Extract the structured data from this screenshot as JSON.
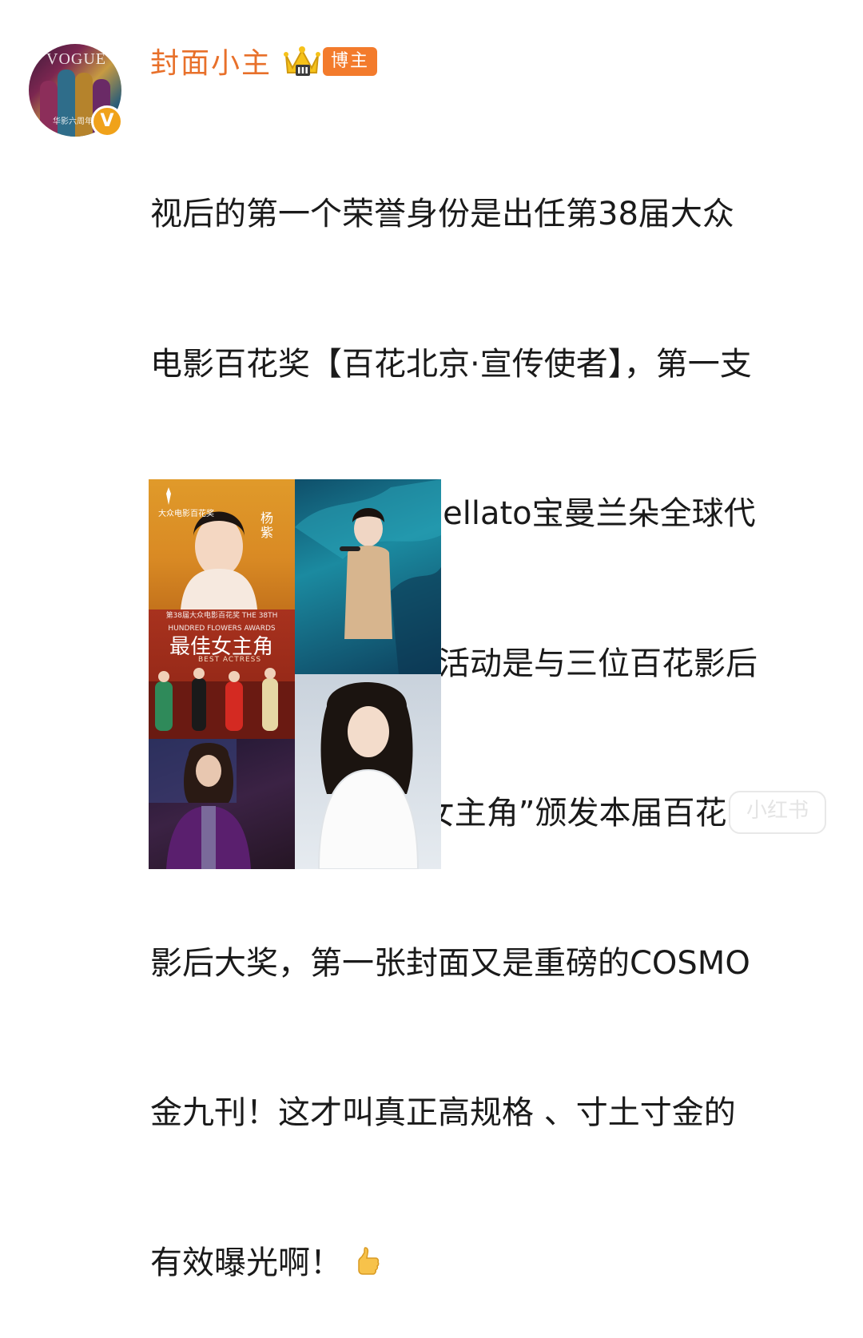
{
  "user": {
    "name": "封面小主",
    "badge": "博主",
    "avatar_text": "VOGUE",
    "avatar_subtext": "华影六周年",
    "verified_mark": "V"
  },
  "post": {
    "lines": [
      "视后的第一个荣誉身份是出任第38届大众",
      "电影百花奖【百花北京·宣传使者】，第一支",
      "商务代言是拿下Pomellato宝曼兰朵全球代",
      "言合约，第一场盛典活动是与三位百花影后",
      "同台作为四代“最佳女主角”颁发本届百花",
      "影后大奖，第一张封面又是重磅的COSMO",
      "金九刊！这才叫真正高规格 、寸土寸金的",
      "有效曝光啊！"
    ],
    "emoji": "thumbs-up-icon"
  },
  "images": {
    "tile1_logo": "大众电影百花奖",
    "tile1_vertical": "杨紫",
    "tile3_banner": "第38届大众电影百花奖 THE 38TH HUNDRED FLOWERS AWARDS",
    "tile3_title": "最佳女主角",
    "tile3_subtitle": "BEST ACTRESS"
  },
  "watermark": "小红书",
  "colors": {
    "username": "#e8702a",
    "badge_bg": "#f37b2c",
    "verified": "#f0a21a",
    "text": "#1a1a1a"
  }
}
